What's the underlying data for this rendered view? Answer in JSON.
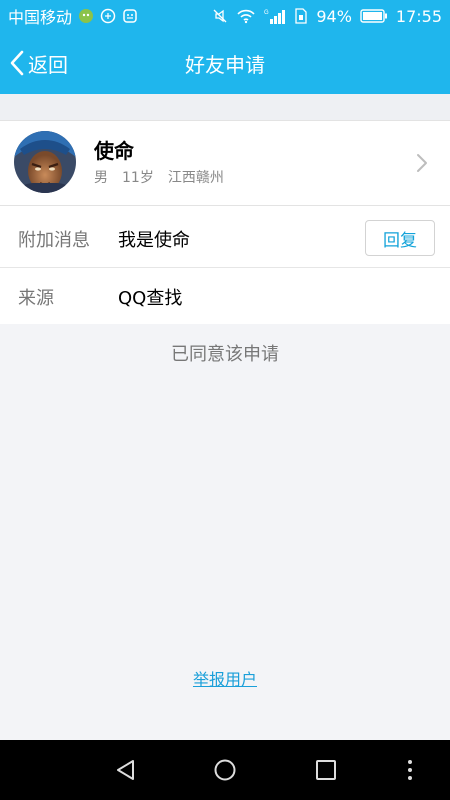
{
  "status_bar": {
    "carrier": "中国移动",
    "battery": "94%",
    "time": "17:55",
    "network": "G"
  },
  "header": {
    "back_label": "返回",
    "title": "好友申请"
  },
  "profile": {
    "name": "使命",
    "gender": "男",
    "age": "11岁",
    "location": "江西赣州"
  },
  "details": {
    "message_label": "附加消息",
    "message_value": "我是使命",
    "reply_button": "回复",
    "source_label": "来源",
    "source_value": "QQ查找"
  },
  "status_text": "已同意该申请",
  "report_link": "举报用户",
  "colors": {
    "brand": "#1fb6ed",
    "link": "#1a9fd9"
  }
}
